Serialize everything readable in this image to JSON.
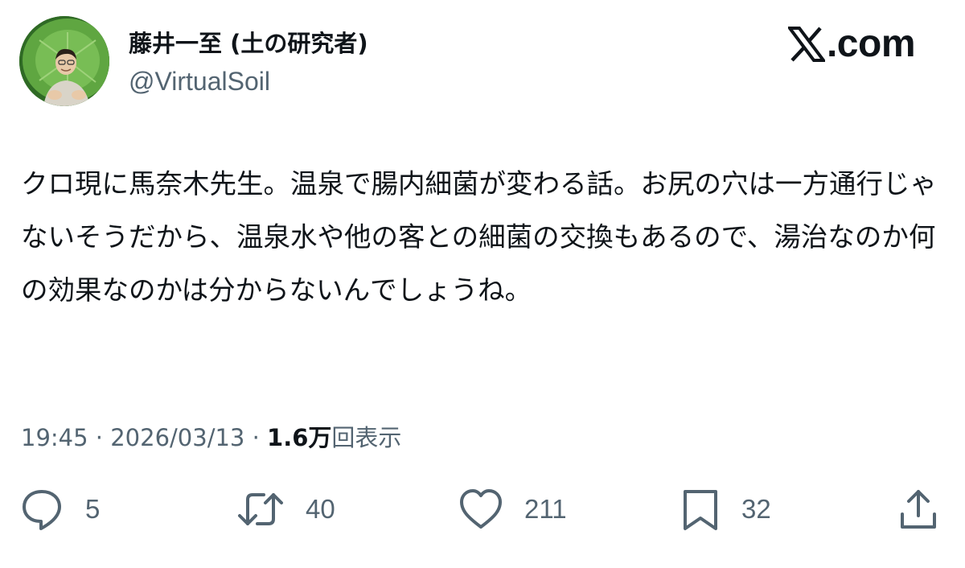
{
  "user": {
    "display_name": "藤井一至 (土の研究者)",
    "handle": "@VirtualSoil",
    "avatar_icon": "profile-photo"
  },
  "brand": {
    "text": ".com",
    "icon": "x-logo-icon"
  },
  "tweet": {
    "text": "クロ現に馬奈木先生。温泉で腸内細菌が変わる話。お尻の穴は一方通行じゃないそうだから、温泉水や他の客との細菌の交換もあるので、湯治なのか何の効果なのかは分からないんでしょうね。"
  },
  "meta": {
    "time": "19:45",
    "separator1": " · ",
    "date": "2026/03/13",
    "separator2": " · ",
    "views_count": "1.6万",
    "views_label": "回表示"
  },
  "actions": {
    "reply": {
      "icon": "reply-icon",
      "count": "5"
    },
    "repost": {
      "icon": "repost-icon",
      "count": "40"
    },
    "like": {
      "icon": "heart-icon",
      "count": "211"
    },
    "bookmark": {
      "icon": "bookmark-icon",
      "count": "32"
    },
    "share": {
      "icon": "share-icon"
    }
  },
  "colors": {
    "text_primary": "#0f1419",
    "text_secondary": "#536471",
    "background": "#ffffff"
  }
}
